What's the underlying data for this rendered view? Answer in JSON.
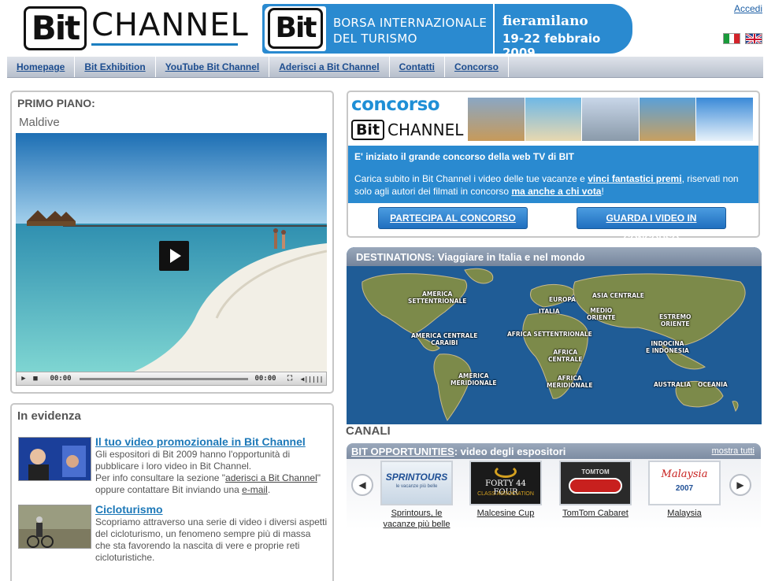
{
  "header": {
    "logo_bit": "Bit",
    "logo_channel": "CHANNEL",
    "banner_bit": "Bit",
    "banner_title_line1": "BORSA INTERNAZIONALE",
    "banner_title_line2": "DEL TURISMO",
    "banner_venue": "fieramilano",
    "banner_dates": "19-22 febbraio 2009",
    "login_link": "Accedi"
  },
  "nav": {
    "items": [
      "Homepage",
      "Bit Exhibition",
      "YouTube Bit Channel",
      "Aderisci a Bit Channel",
      "Contatti",
      "Concorso"
    ]
  },
  "primo_piano": {
    "title": "PRIMO PIANO:",
    "video_title": "Maldive",
    "time_current": "00:00",
    "time_total": "00:00"
  },
  "evidenza": {
    "title": "In evidenza",
    "items": [
      {
        "title": "Il tuo video promozionale in Bit Channel",
        "text_a": "Gli espositori di Bit 2009 hanno l'opportunità di pubblicare i loro video in Bit Channel.",
        "text_b": "Per info consultare la sezione \"",
        "link_a": "aderisci a Bit Channel",
        "text_c": "\" oppure contattare Bit inviando una ",
        "link_b": "e-mail",
        "text_d": "."
      },
      {
        "title": "Cicloturismo",
        "text": "Scopriamo attraverso una serie di video i diversi aspetti del cicloturismo, un fenomeno sempre più di massa che sta favorendo la nascita di vere e proprie reti cicloturistiche."
      }
    ]
  },
  "concorso": {
    "logo_word": "concorso",
    "logo_bit": "Bit",
    "logo_channel": "CHANNEL",
    "headline": "E' iniziato il grande concorso della web TV di BIT",
    "text_a": "Carica subito in Bit Channel i video delle tue vacanze e ",
    "link_a": "vinci fantastici premi",
    "text_b": ", riservati non solo agli autori dei filmati in concorso ",
    "link_b": "ma anche a chi vota",
    "text_c": "!",
    "button_partecipa": "PARTECIPA AL CONCORSO",
    "button_guarda": "GUARDA I VIDEO IN CONCORSO"
  },
  "destinations": {
    "title": "DESTINATIONS: Viaggiare in Italia e nel mondo",
    "regions": [
      {
        "name": "AMERICA SETTENTRIONALE",
        "line1": "AMERICA",
        "line2": "SETTENTRIONALE"
      },
      {
        "name": "EUROPA",
        "line1": "EUROPA",
        "line2": ""
      },
      {
        "name": "ASIA CENTRALE",
        "line1": "ASIA CENTRALE",
        "line2": ""
      },
      {
        "name": "ITALIA",
        "line1": "ITALIA",
        "line2": ""
      },
      {
        "name": "MEDIO ORIENTE",
        "line1": "MEDIO",
        "line2": "ORIENTE"
      },
      {
        "name": "ESTREMO ORIENTE",
        "line1": "ESTREMO",
        "line2": "ORIENTE"
      },
      {
        "name": "AMERICA CENTRALE CARAIBI",
        "line1": "AMERICA CENTRALE",
        "line2": "CARAIBI"
      },
      {
        "name": "AFRICA SETTENTRIONALE",
        "line1": "AFRICA SETTENTRIONALE",
        "line2": ""
      },
      {
        "name": "INDOCINA E INDONESIA",
        "line1": "INDOCINA",
        "line2": "E INDONESIA"
      },
      {
        "name": "AFRICA CENTRALE",
        "line1": "AFRICA",
        "line2": "CENTRALE"
      },
      {
        "name": "AMERICA MERIDIONALE",
        "line1": "AMERICA",
        "line2": "MERIDIONALE"
      },
      {
        "name": "AFRICA MERIDIONALE",
        "line1": "AFRICA",
        "line2": "MERIDIONALE"
      },
      {
        "name": "AUSTRALIA",
        "line1": "AUSTRALIA",
        "line2": ""
      },
      {
        "name": "OCEANIA",
        "line1": "OCEANIA",
        "line2": ""
      }
    ]
  },
  "canali": {
    "title": "CANALI",
    "section_link": "BIT OPPORTUNITIES",
    "section_rest": ": video degli espositori",
    "show_all": "mostra tutti",
    "items": [
      {
        "caption_1": "Sprintours, le",
        "caption_2": "vacanze più belle",
        "thumb_text": "SPRINTOURS",
        "thumb_sub": "le vacanze più belle"
      },
      {
        "caption_1": "Malcesine Cup",
        "caption_2": "",
        "thumb_text": "FORTY 44 FOUR",
        "thumb_sub": "CLASS ASSOCIATION"
      },
      {
        "caption_1": "TomTom Cabaret",
        "caption_2": "",
        "thumb_text": "TOMTOM",
        "thumb_sub": ""
      },
      {
        "caption_1": "Malaysia",
        "caption_2": "",
        "thumb_text": "Malaysia",
        "thumb_sub": "2007"
      }
    ]
  },
  "colors": {
    "brand_blue": "#2a8ad0",
    "link_blue": "#1c78b8",
    "nav_text": "#1d4d8f"
  }
}
